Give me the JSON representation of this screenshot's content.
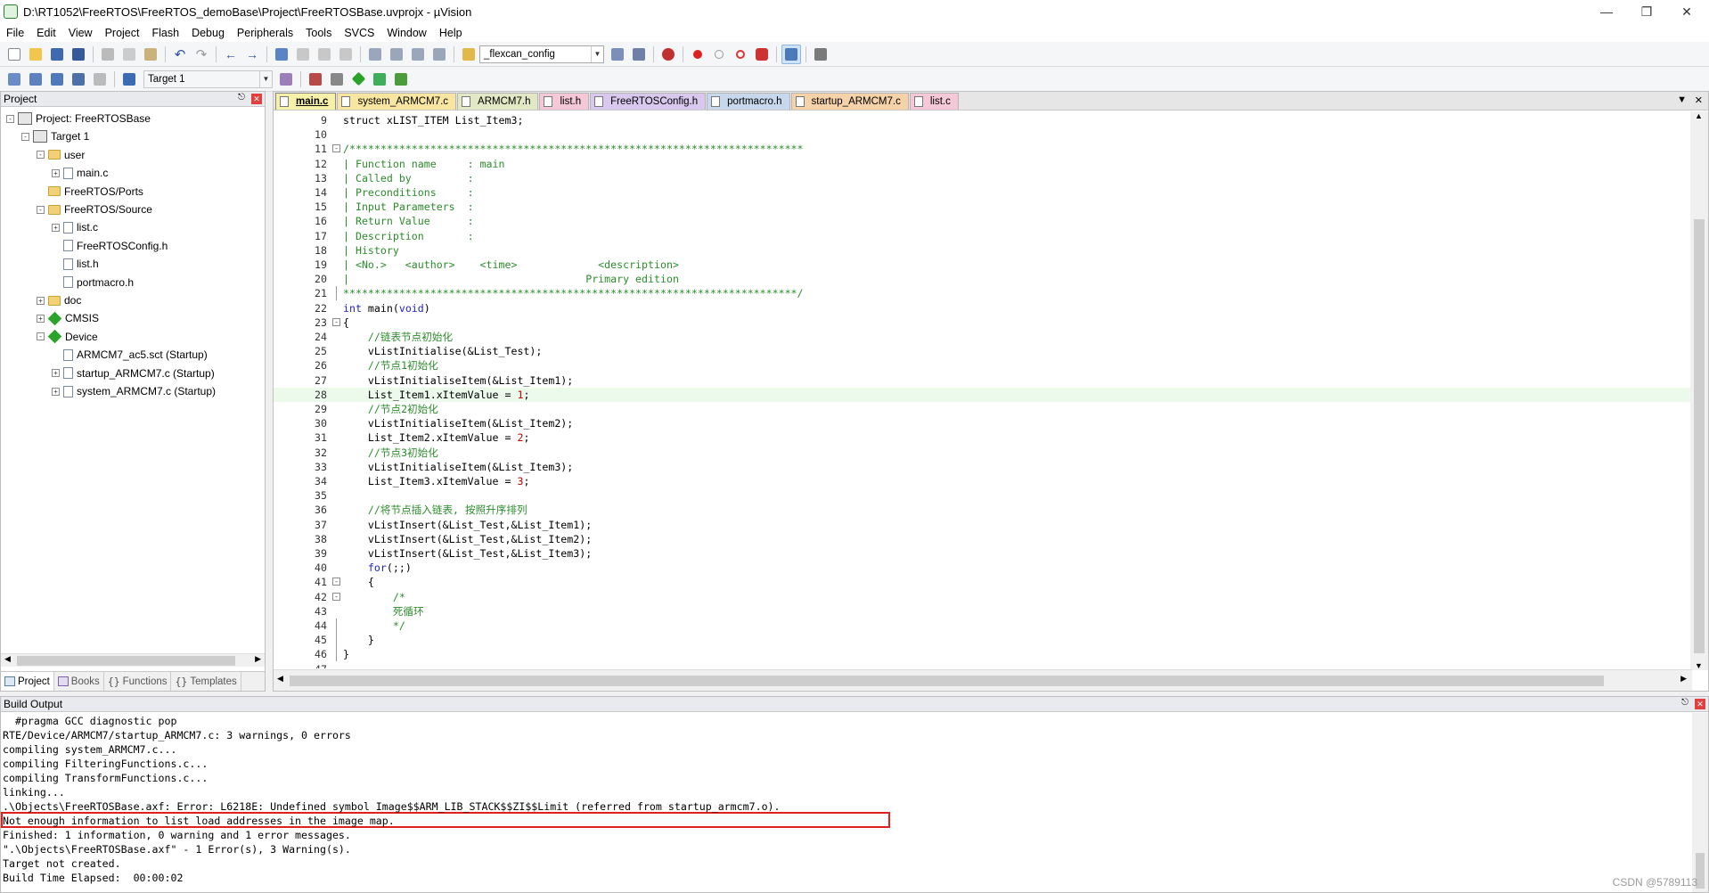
{
  "window": {
    "title": "D:\\RT1052\\FreeRTOS\\FreeRTOS_demoBase\\Project\\FreeRTOSBase.uvprojx - µVision"
  },
  "menu": [
    "File",
    "Edit",
    "View",
    "Project",
    "Flash",
    "Debug",
    "Peripherals",
    "Tools",
    "SVCS",
    "Window",
    "Help"
  ],
  "toolbar": {
    "find_combo": "_flexcan_config",
    "target_combo": "Target 1"
  },
  "project_panel": {
    "title": "Project",
    "tree": [
      {
        "label": "Project: FreeRTOSBase",
        "level": 0,
        "expander": "-",
        "icon": "project-icon"
      },
      {
        "label": "Target 1",
        "level": 1,
        "expander": "-",
        "icon": "target-icon"
      },
      {
        "label": "user",
        "level": 2,
        "expander": "-",
        "icon": "folder-icon"
      },
      {
        "label": "main.c",
        "level": 3,
        "expander": "+",
        "icon": "file-icon"
      },
      {
        "label": "FreeRTOS/Ports",
        "level": 2,
        "expander": "",
        "icon": "folder-icon"
      },
      {
        "label": "FreeRTOS/Source",
        "level": 2,
        "expander": "-",
        "icon": "folder-icon"
      },
      {
        "label": "list.c",
        "level": 3,
        "expander": "+",
        "icon": "file-icon"
      },
      {
        "label": "FreeRTOSConfig.h",
        "level": 3,
        "expander": "",
        "icon": "file-icon"
      },
      {
        "label": "list.h",
        "level": 3,
        "expander": "",
        "icon": "file-icon"
      },
      {
        "label": "portmacro.h",
        "level": 3,
        "expander": "",
        "icon": "file-icon"
      },
      {
        "label": "doc",
        "level": 2,
        "expander": "+",
        "icon": "folder-icon"
      },
      {
        "label": "CMSIS",
        "level": 2,
        "expander": "+",
        "icon": "component-icon"
      },
      {
        "label": "Device",
        "level": 2,
        "expander": "-",
        "icon": "component-icon"
      },
      {
        "label": "ARMCM7_ac5.sct (Startup)",
        "level": 3,
        "expander": "",
        "icon": "file-icon"
      },
      {
        "label": "startup_ARMCM7.c (Startup)",
        "level": 3,
        "expander": "+",
        "icon": "file-icon"
      },
      {
        "label": "system_ARMCM7.c (Startup)",
        "level": 3,
        "expander": "+",
        "icon": "file-icon"
      }
    ],
    "bottom_tabs": [
      "Project",
      "Books",
      "Functions",
      "Templates"
    ]
  },
  "editor": {
    "tabs": [
      {
        "label": "main.c",
        "color": "#f6f0a8",
        "active": true
      },
      {
        "label": "system_ARMCM7.c",
        "color": "#f8e6a0"
      },
      {
        "label": "ARMCM7.h",
        "color": "#e2e7c4"
      },
      {
        "label": "list.h",
        "color": "#f4c8d6"
      },
      {
        "label": "FreeRTOSConfig.h",
        "color": "#d9c8ee"
      },
      {
        "label": "portmacro.h",
        "color": "#c8d8ec"
      },
      {
        "label": "startup_ARMCM7.c",
        "color": "#f6d2a8"
      },
      {
        "label": "list.c",
        "color": "#f4c8d6"
      }
    ],
    "lines": [
      {
        "n": "9",
        "text": "struct xLIST_ITEM List_Item3;"
      },
      {
        "n": "10",
        "text": ""
      },
      {
        "n": "11",
        "text": "/*************************************************************************",
        "fold": "-",
        "cls": "cm"
      },
      {
        "n": "12",
        "text": "| Function name     : main",
        "cls": "cm"
      },
      {
        "n": "13",
        "text": "| Called by         :",
        "cls": "cm"
      },
      {
        "n": "14",
        "text": "| Preconditions     :",
        "cls": "cm"
      },
      {
        "n": "15",
        "text": "| Input Parameters  :",
        "cls": "cm"
      },
      {
        "n": "16",
        "text": "| Return Value      :",
        "cls": "cm"
      },
      {
        "n": "17",
        "text": "| Description       :",
        "cls": "cm"
      },
      {
        "n": "18",
        "text": "| History",
        "cls": "cm"
      },
      {
        "n": "19",
        "text": "| <No.>   <author>    <time>             <description>",
        "cls": "cm"
      },
      {
        "n": "20",
        "text": "|                                      Primary edition",
        "cls": "cm"
      },
      {
        "n": "21",
        "text": "*************************************************************************/",
        "cls": "cm",
        "vend": true
      },
      {
        "n": "22",
        "text": "int main(void)",
        "kw": "int,void"
      },
      {
        "n": "23",
        "text": "{",
        "fold": "-"
      },
      {
        "n": "24",
        "text": "    //链表节点初始化",
        "cls": "cm"
      },
      {
        "n": "25",
        "text": "    vListInitialise(&List_Test);"
      },
      {
        "n": "26",
        "text": "    //节点1初始化",
        "cls": "cm"
      },
      {
        "n": "27",
        "text": "    vListInitialiseItem(&List_Item1);"
      },
      {
        "n": "28",
        "text": "    List_Item1.xItemValue = 1;",
        "cur": true,
        "num": "1"
      },
      {
        "n": "29",
        "text": "    //节点2初始化",
        "cls": "cm"
      },
      {
        "n": "30",
        "text": "    vListInitialiseItem(&List_Item2);"
      },
      {
        "n": "31",
        "text": "    List_Item2.xItemValue = 2;",
        "num": "2"
      },
      {
        "n": "32",
        "text": "    //节点3初始化",
        "cls": "cm"
      },
      {
        "n": "33",
        "text": "    vListInitialiseItem(&List_Item3);"
      },
      {
        "n": "34",
        "text": "    List_Item3.xItemValue = 3;",
        "num": "3"
      },
      {
        "n": "35",
        "text": ""
      },
      {
        "n": "36",
        "text": "    //将节点插入链表, 按照升序排列",
        "cls": "cm"
      },
      {
        "n": "37",
        "text": "    vListInsert(&List_Test,&List_Item1);"
      },
      {
        "n": "38",
        "text": "    vListInsert(&List_Test,&List_Item2);"
      },
      {
        "n": "39",
        "text": "    vListInsert(&List_Test,&List_Item3);"
      },
      {
        "n": "40",
        "text": "    for(;;)",
        "kw": "for"
      },
      {
        "n": "41",
        "text": "    {",
        "fold": "-"
      },
      {
        "n": "42",
        "text": "        /*",
        "cls": "cm",
        "fold": "-"
      },
      {
        "n": "43",
        "text": "        死循环",
        "cls": "cm"
      },
      {
        "n": "44",
        "text": "        */",
        "cls": "cm",
        "vend": true
      },
      {
        "n": "45",
        "text": "    }",
        "vend": true
      },
      {
        "n": "46",
        "text": "}",
        "vend": true
      },
      {
        "n": "47",
        "text": ""
      }
    ]
  },
  "build_output": {
    "title": "Build Output",
    "lines": [
      "  #pragma GCC diagnostic pop",
      "RTE/Device/ARMCM7/startup_ARMCM7.c: 3 warnings, 0 errors",
      "compiling system_ARMCM7.c...",
      "compiling FilteringFunctions.c...",
      "compiling TransformFunctions.c...",
      "linking...",
      ".\\Objects\\FreeRTOSBase.axf: Error: L6218E: Undefined symbol Image$$ARM_LIB_STACK$$ZI$$Limit (referred from startup_armcm7.o).",
      "Not enough information to list load addresses in the image map.",
      "Finished: 1 information, 0 warning and 1 error messages.",
      "\".\\Objects\\FreeRTOSBase.axf\" - 1 Error(s), 3 Warning(s).",
      "Target not created.",
      "Build Time Elapsed:  00:00:02"
    ]
  },
  "watermark": "CSDN @5789113"
}
